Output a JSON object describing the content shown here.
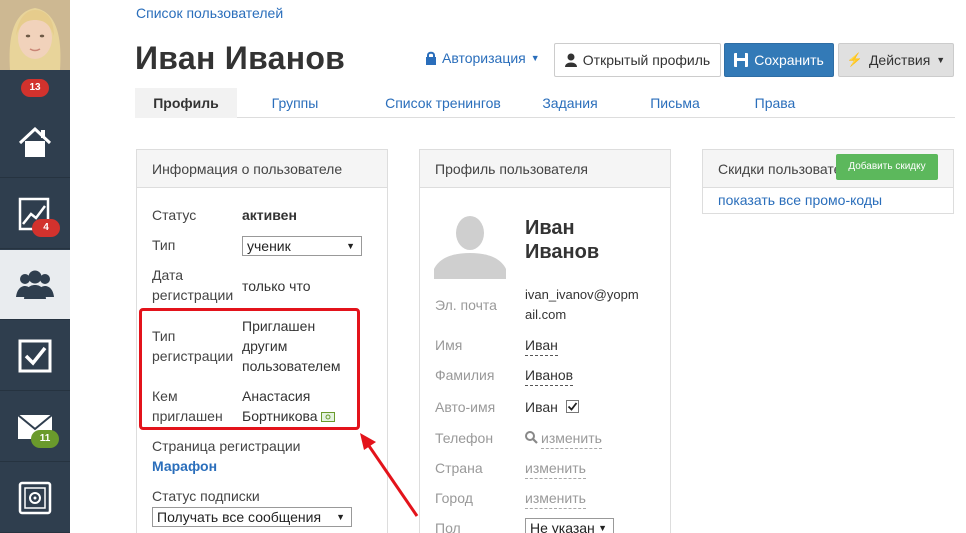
{
  "sidebar": {
    "avatar_alt": "",
    "badges": {
      "top": "13",
      "stats": "4",
      "mail": "11"
    },
    "items": [
      {
        "name": "home",
        "icon": "home-icon"
      },
      {
        "name": "stats",
        "icon": "trend-chart-icon"
      },
      {
        "name": "users",
        "icon": "users-icon",
        "active": true
      },
      {
        "name": "tasks",
        "icon": "checkbox-icon"
      },
      {
        "name": "mail",
        "icon": "envelope-icon"
      },
      {
        "name": "settings",
        "icon": "safe-icon"
      }
    ]
  },
  "header": {
    "breadcrumb": "Список пользователей",
    "title": "Иван Иванов",
    "auth_label": "Авторизация",
    "open_profile_label": "Открытый профиль",
    "save_label": "Сохранить",
    "actions_label": "Действия"
  },
  "tabs": [
    {
      "label": "Профиль",
      "active": true
    },
    {
      "label": "Группы"
    },
    {
      "label": "Список тренингов"
    },
    {
      "label": "Задания"
    },
    {
      "label": "Письма"
    },
    {
      "label": "Права"
    }
  ],
  "user_info": {
    "title": "Информация о пользователе",
    "status_label": "Статус",
    "status_value": "активен",
    "type_label": "Тип",
    "type_value": "ученик",
    "reg_date_label_1": "Дата",
    "reg_date_label_2": "регистрации",
    "reg_date_value": "только что",
    "reg_type_label_1": "Тип",
    "reg_type_label_2": "регистрации",
    "reg_type_value_1": "Приглашен",
    "reg_type_value_2": "другим",
    "reg_type_value_3": "пользователем",
    "invited_by_label_1": "Кем",
    "invited_by_label_2": "приглашен",
    "invited_by_value_1": "Анастасия",
    "invited_by_value_2": "Бортникова",
    "reg_page_label": "Страница регистрации",
    "reg_page_value": "Марафон",
    "subscription_label": "Статус подписки",
    "subscription_value": "Получать все сообщения"
  },
  "profile": {
    "title": "Профиль пользователя",
    "name_line_1": "Иван",
    "name_line_2": "Иванов",
    "email_label": "Эл. почта",
    "email_value_1": "ivan_ivanov@yopm",
    "email_value_2": "ail.com",
    "first_name_label": "Имя",
    "first_name_value": "Иван",
    "last_name_label": "Фамилия",
    "last_name_value": "Иванов",
    "auto_name_label": "Авто-имя",
    "auto_name_value": "Иван",
    "phone_label": "Телефон",
    "phone_value": "изменить",
    "country_label": "Страна",
    "country_value": "изменить",
    "city_label": "Город",
    "city_value": "изменить",
    "gender_label": "Пол",
    "gender_value": "Не указан"
  },
  "discounts": {
    "title": "Скидки пользовате",
    "add_label": "Добавить скидку",
    "promo_link": "показать все промо-коды"
  },
  "colors": {
    "sidebar": "#2f3e4e",
    "accent": "#2a6ebb",
    "save": "#337ab7",
    "add_discount": "#5cb85c",
    "highlight": "#e3131b"
  }
}
